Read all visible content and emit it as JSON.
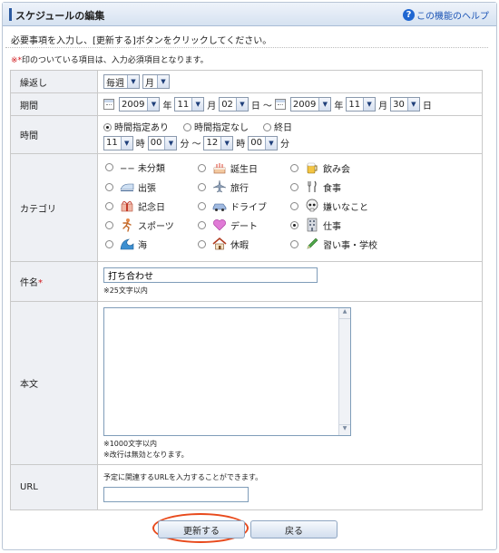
{
  "header": {
    "title": "スケジュールの編集",
    "help_label": "この機能のヘルプ",
    "help_icon": "?"
  },
  "instruction": "必要事項を入力し、[更新する]ボタンをクリックしてください。",
  "required_note": {
    "mark": "※*",
    "text": "印のついている項目は、入力必須項目となります。"
  },
  "repeat": {
    "label": "繰返し",
    "freq": "毎週",
    "unit": "月"
  },
  "period": {
    "label": "期間",
    "start": {
      "year": "2009",
      "month": "11",
      "day": "02"
    },
    "end": {
      "year": "2009",
      "month": "11",
      "day": "30"
    },
    "year_unit": "年",
    "month_unit": "月",
    "day_unit": "日",
    "tilde": "～"
  },
  "time": {
    "label": "時間",
    "options": [
      "時間指定あり",
      "時間指定なし",
      "終日"
    ],
    "selected": "時間指定あり",
    "start_hour": "11",
    "start_min": "00",
    "end_hour": "12",
    "end_min": "00",
    "hour_unit": "時",
    "min_unit": "分",
    "tilde": "～"
  },
  "category": {
    "label": "カテゴリ",
    "items": [
      {
        "label": "−− 未分類",
        "icon": "none"
      },
      {
        "label": "誕生日",
        "icon": "cake-icon"
      },
      {
        "label": "飲み会",
        "icon": "beer-icon"
      },
      {
        "label": "出張",
        "icon": "train-icon"
      },
      {
        "label": "旅行",
        "icon": "airplane-icon"
      },
      {
        "label": "食事",
        "icon": "fork-knife-icon"
      },
      {
        "label": "記念日",
        "icon": "gift-icon"
      },
      {
        "label": "ドライブ",
        "icon": "car-icon"
      },
      {
        "label": "嫌いなこと",
        "icon": "skull-icon"
      },
      {
        "label": "スポーツ",
        "icon": "runner-icon"
      },
      {
        "label": "デート",
        "icon": "heart-icon"
      },
      {
        "label": "仕事",
        "icon": "building-icon"
      },
      {
        "label": "海",
        "icon": "wave-icon"
      },
      {
        "label": "休暇",
        "icon": "house-icon"
      },
      {
        "label": "習い事・学校",
        "icon": "pencil-icon"
      }
    ],
    "selected": "仕事"
  },
  "subject": {
    "label": "件名",
    "required_mark": "*",
    "value": "打ち合わせ",
    "hint": "※25文字以内"
  },
  "body": {
    "label": "本文",
    "value": "",
    "hint1": "※1000文字以内",
    "hint2": "※改行は無効となります。"
  },
  "url": {
    "label": "URL",
    "note": "予定に関連するURLを入力することができます。",
    "value": ""
  },
  "buttons": {
    "update": "更新する",
    "back": "戻る"
  },
  "colors": {
    "accent": "#2c5aa0",
    "required": "#d0181c",
    "highlight": "#e84a1c"
  }
}
